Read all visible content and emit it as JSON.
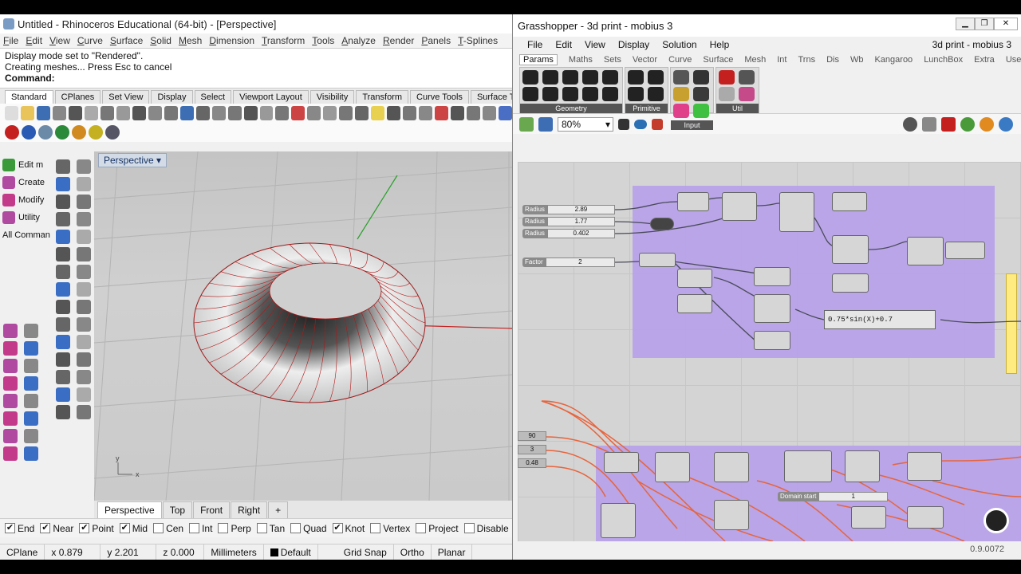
{
  "rhino": {
    "title": "Untitled - Rhinoceros Educational (64-bit) - [Perspective]",
    "menu": [
      "File",
      "Edit",
      "View",
      "Curve",
      "Surface",
      "Solid",
      "Mesh",
      "Dimension",
      "Transform",
      "Tools",
      "Analyze",
      "Render",
      "Panels",
      "T-Splines"
    ],
    "history": [
      "Display mode set to \"Rendered\".",
      "Creating meshes... Press Esc to cancel"
    ],
    "command_label": "Command:",
    "tabs": [
      "Standard",
      "CPlanes",
      "Set View",
      "Display",
      "Select",
      "Viewport Layout",
      "Visibility",
      "Transform",
      "Curve Tools",
      "Surface T"
    ],
    "left_commands": [
      "Edit m",
      "Create",
      "Modify",
      "Utility",
      "All Comman"
    ],
    "viewport_label": "Perspective",
    "viewport_tabs": [
      "Perspective",
      "Top",
      "Front",
      "Right",
      "+"
    ],
    "osnaps": [
      {
        "label": "End",
        "checked": true
      },
      {
        "label": "Near",
        "checked": true
      },
      {
        "label": "Point",
        "checked": true
      },
      {
        "label": "Mid",
        "checked": true
      },
      {
        "label": "Cen",
        "checked": false
      },
      {
        "label": "Int",
        "checked": false
      },
      {
        "label": "Perp",
        "checked": false
      },
      {
        "label": "Tan",
        "checked": false
      },
      {
        "label": "Quad",
        "checked": false
      },
      {
        "label": "Knot",
        "checked": true
      },
      {
        "label": "Vertex",
        "checked": false
      },
      {
        "label": "Project",
        "checked": false
      },
      {
        "label": "Disable",
        "checked": false
      }
    ],
    "status": {
      "cplane": "CPlane",
      "x": "x 0.879",
      "y": "y 2.201",
      "z": "z 0.000",
      "units": "Millimeters",
      "layer": "Default",
      "grid": "Grid Snap",
      "ortho": "Ortho",
      "planar": "Planar"
    }
  },
  "gh": {
    "title": "Grasshopper - 3d print - mobius 3",
    "menu": [
      "File",
      "Edit",
      "View",
      "Display",
      "Solution",
      "Help"
    ],
    "doc_name": "3d print - mobius 3",
    "tabs": [
      "Params",
      "Maths",
      "Sets",
      "Vector",
      "Curve",
      "Surface",
      "Mesh",
      "Int",
      "Trns",
      "Dis",
      "Wb",
      "Kangaroo",
      "LunchBox",
      "Extra",
      "User"
    ],
    "ribbon_groups": [
      "Geometry",
      "Primitive",
      "Input",
      "Util"
    ],
    "zoom": "80%",
    "sliders": [
      {
        "name": "Radius",
        "value": "2.89"
      },
      {
        "name": "Radius",
        "value": "1.77"
      },
      {
        "name": "Radius",
        "value": "0.402"
      },
      {
        "name": "Factor",
        "value": "2"
      }
    ],
    "expression": "0.75*sin(X)+0.7",
    "domain_label": "Domain start",
    "lower_values": [
      "90",
      "3",
      "0.48"
    ],
    "version": "0.9.0072"
  },
  "colors": {
    "group": "#b7a2e8",
    "wire": "#e8643c",
    "surface_edge": "#b01818"
  }
}
